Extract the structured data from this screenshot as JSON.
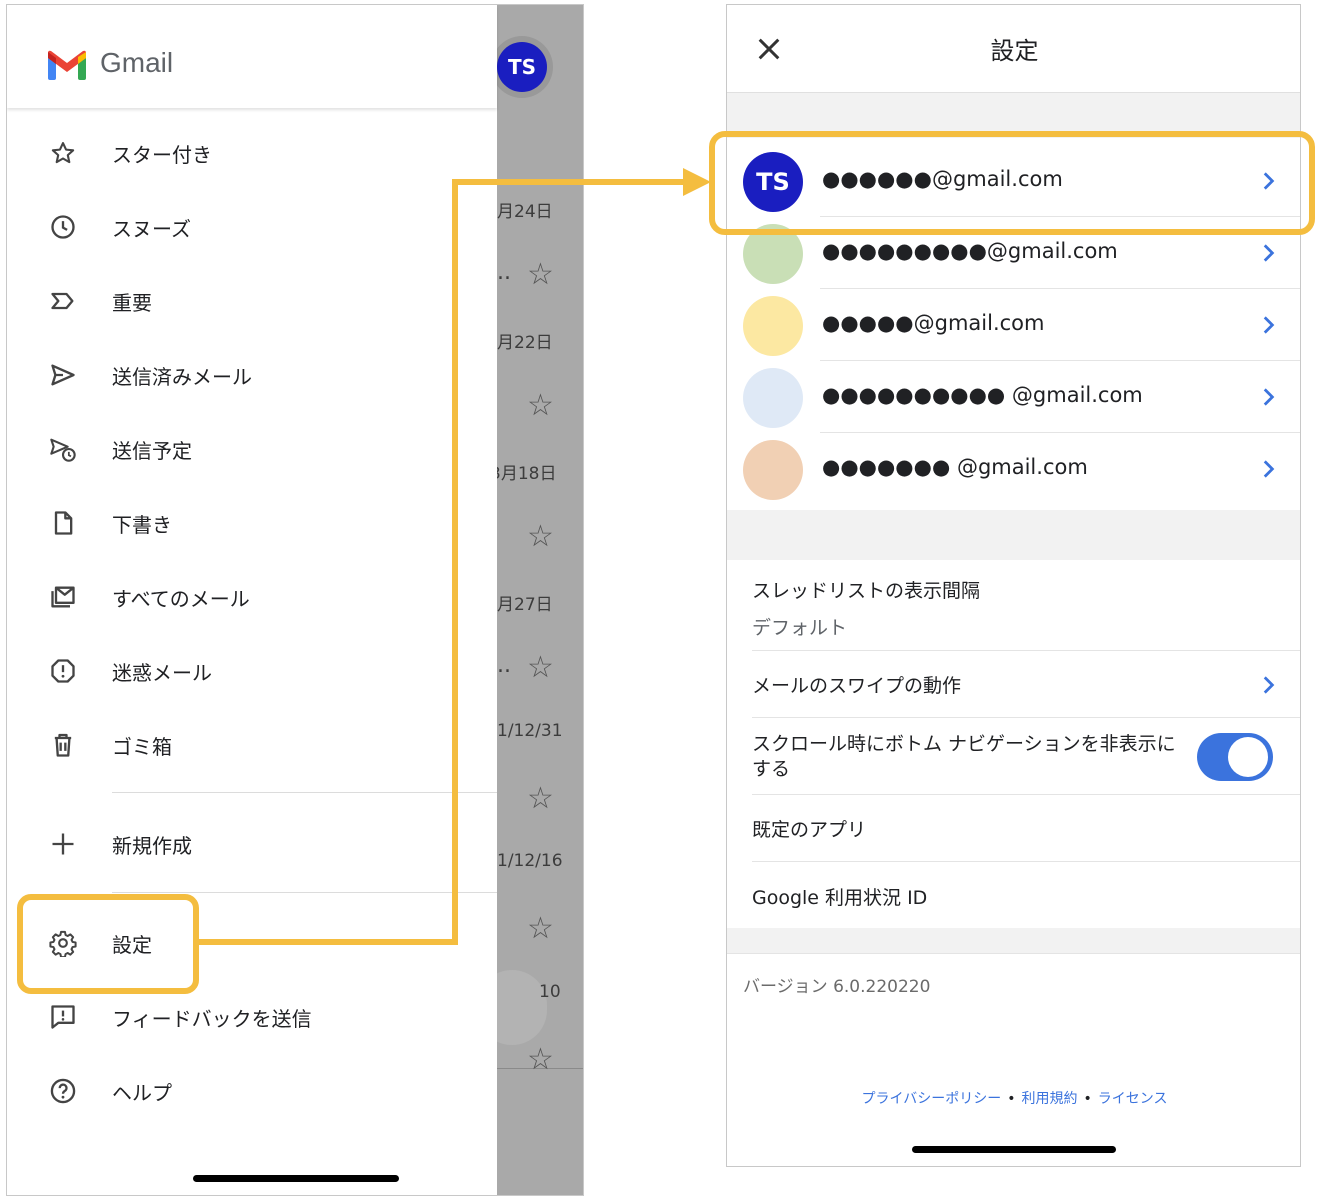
{
  "left": {
    "app_title": "Gmail",
    "avatar_initials": "TS",
    "background_dates": [
      "月24日",
      "月22日",
      "3月18日",
      "月27日",
      "1/12/31",
      "1/12/16",
      "10"
    ],
    "background_ellipsis": "..",
    "nav_items": [
      {
        "label": "スター付き",
        "icon": "star-icon"
      },
      {
        "label": "スヌーズ",
        "icon": "clock-icon"
      },
      {
        "label": "重要",
        "icon": "important-icon"
      },
      {
        "label": "送信済みメール",
        "icon": "send-icon"
      },
      {
        "label": "送信予定",
        "icon": "scheduled-send-icon"
      },
      {
        "label": "下書き",
        "icon": "draft-icon"
      },
      {
        "label": "すべてのメール",
        "icon": "all-mail-icon"
      },
      {
        "label": "迷惑メール",
        "icon": "spam-icon"
      },
      {
        "label": "ゴミ箱",
        "icon": "trash-icon"
      },
      {
        "label": "新規作成",
        "icon": "plus-icon"
      },
      {
        "label": "設定",
        "icon": "gear-icon"
      },
      {
        "label": "フィードバックを送信",
        "icon": "feedback-icon"
      },
      {
        "label": "ヘルプ",
        "icon": "help-icon"
      }
    ]
  },
  "right": {
    "title": "設定",
    "accounts": [
      {
        "email": "●●●●●●@gmail.com",
        "avatar_initials": "TS",
        "avatar_color": "#1a1ec0"
      },
      {
        "email": "●●●●●●●●●@gmail.com",
        "avatar_initials": "",
        "avatar_color": "#c9dfb6"
      },
      {
        "email": "●●●●●@gmail.com",
        "avatar_initials": "",
        "avatar_color": "#fce8a2"
      },
      {
        "email": "●●●●●●●●●● @gmail.com",
        "avatar_initials": "",
        "avatar_color": "#dfe9f6"
      },
      {
        "email": "●●●●●●● @gmail.com",
        "avatar_initials": "",
        "avatar_color": "#f1d0b4"
      }
    ],
    "settings": {
      "thread_density_label": "スレッドリストの表示間隔",
      "thread_density_value": "デフォルト",
      "swipe_label": "メールのスワイプの動作",
      "hide_nav_label": "スクロール時にボトム ナビゲーションを非表示にする",
      "hide_nav_enabled": true,
      "default_apps_label": "既定のアプリ",
      "usage_id_label": "Google 利用状況 ID"
    },
    "version": "バージョン 6.0.220220",
    "footer_links": {
      "privacy": "プライバシーポリシー",
      "terms": "利用規約",
      "license": "ライセンス",
      "separator": "•"
    }
  },
  "colors": {
    "highlight": "#f4bd3f",
    "accent_blue": "#3b73dd",
    "primary_avatar": "#1a1ec0"
  }
}
